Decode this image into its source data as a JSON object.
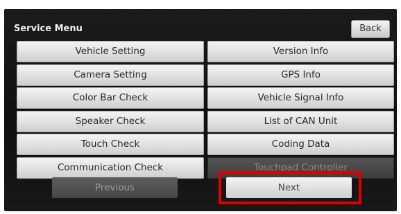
{
  "header": {
    "title": "Service Menu",
    "back_label": "Back"
  },
  "menu": {
    "left": [
      "Vehicle Setting",
      "Camera Setting",
      "Color Bar Check",
      "Speaker Check",
      "Touch Check",
      "Communication Check"
    ],
    "right": [
      "Version Info",
      "GPS Info",
      "Vehicle Signal Info",
      "List of CAN Unit",
      "Coding Data",
      "Touchpad Controller"
    ]
  },
  "nav": {
    "previous_label": "Previous",
    "next_label": "Next"
  },
  "colors": {
    "highlight": "#e00000",
    "screen_bg": "#141414",
    "button_face": "#e6e6e6"
  }
}
